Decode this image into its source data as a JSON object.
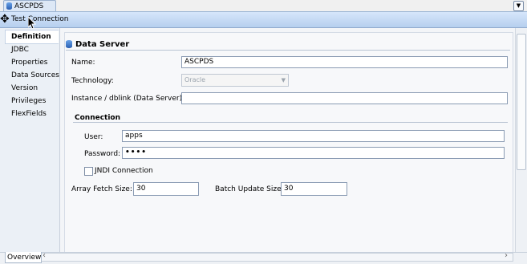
{
  "document_tab": {
    "label": "ASCPDS"
  },
  "toolbar": {
    "label": "Test Connection"
  },
  "sidebar": {
    "items": [
      {
        "label": "Definition",
        "active": true
      },
      {
        "label": "JDBC"
      },
      {
        "label": "Properties"
      },
      {
        "label": "Data Sources"
      },
      {
        "label": "Version"
      },
      {
        "label": "Privileges"
      },
      {
        "label": "FlexFields"
      }
    ]
  },
  "section": {
    "title": "Data Server"
  },
  "form": {
    "name_label": "Name:",
    "name_value": "ASCPDS",
    "technology_label": "Technology:",
    "technology_value": "Oracle",
    "instance_label": "Instance / dblink (Data Server):",
    "instance_value": "",
    "connection_title": "Connection",
    "user_label": "User:",
    "user_value": "apps",
    "password_label": "Password:",
    "password_value": "••••",
    "jndi_label": "JNDI Connection",
    "jndi_checked": false,
    "array_fetch_label": "Array Fetch Size:",
    "array_fetch_value": "30",
    "batch_update_label": "Batch Update Size:",
    "batch_update_value": "30"
  },
  "bottom": {
    "tab_label": "Overview"
  },
  "icons": {
    "tab_icon": "database-icon",
    "section_icon": "database-icon",
    "menu_icon": "chevron-down-icon",
    "cursor_move": "move-cursor-icon",
    "cursor_arrow": "arrow-cursor-icon"
  }
}
